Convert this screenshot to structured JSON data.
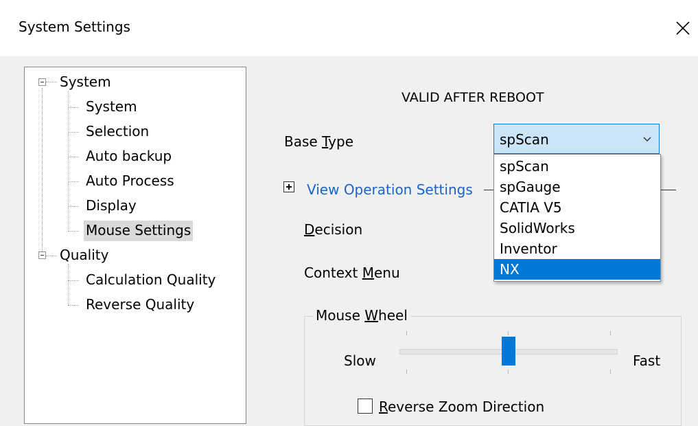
{
  "window": {
    "title": "System Settings"
  },
  "tree": {
    "system_group": "System",
    "system_items": [
      "System",
      "Selection",
      "Auto backup",
      "Auto Process",
      "Display",
      "Mouse Settings"
    ],
    "quality_group": "Quality",
    "quality_items": [
      "Calculation Quality",
      "Reverse Quality"
    ],
    "selected": "Mouse Settings"
  },
  "settings": {
    "section_title": "VALID AFTER REBOOT",
    "base_type": {
      "label_pre": "Base ",
      "label_ul": "T",
      "label_post": "ype",
      "value": "spScan",
      "options": [
        "spScan",
        "spGauge",
        "CATIA V5",
        "SolidWorks",
        "Inventor",
        "NX"
      ],
      "highlighted": "NX"
    },
    "view_operation_link": "View Operation Settings",
    "decision": {
      "ul": "D",
      "rest": "ecision"
    },
    "context_menu": {
      "pre": "Context ",
      "ul": "M",
      "rest": "enu"
    },
    "mouse_wheel": {
      "legend_pre": "Mouse ",
      "legend_ul": "W",
      "legend_rest": "heel",
      "slow": "Slow",
      "fast": "Fast",
      "position": 0.5
    },
    "reverse_zoom": {
      "ul": "R",
      "rest": "everse Zoom Direction",
      "checked": false
    }
  },
  "colors": {
    "accent": "#0078d7",
    "link": "#1a64c8",
    "combo_bg": "#cce4f7"
  }
}
